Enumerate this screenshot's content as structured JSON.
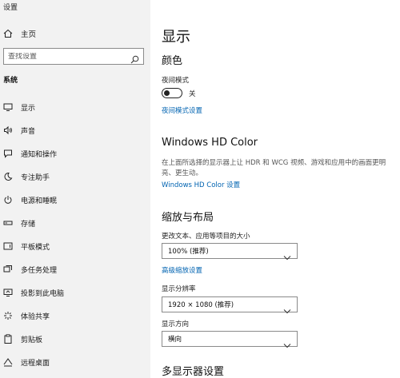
{
  "window": {
    "title": "设置"
  },
  "sidebar": {
    "home_label": "主页",
    "search_placeholder": "查找设置",
    "section_header": "系统",
    "items": [
      {
        "label": "显示",
        "icon": "monitor-icon"
      },
      {
        "label": "声音",
        "icon": "speaker-icon"
      },
      {
        "label": "通知和操作",
        "icon": "notification-icon"
      },
      {
        "label": "专注助手",
        "icon": "moon-icon"
      },
      {
        "label": "电源和睡眠",
        "icon": "power-icon"
      },
      {
        "label": "存储",
        "icon": "storage-icon"
      },
      {
        "label": "平板模式",
        "icon": "tablet-icon"
      },
      {
        "label": "多任务处理",
        "icon": "multitask-icon"
      },
      {
        "label": "投影到此电脑",
        "icon": "project-icon"
      },
      {
        "label": "体验共享",
        "icon": "share-icon"
      },
      {
        "label": "剪贴板",
        "icon": "clipboard-icon"
      },
      {
        "label": "远程桌面",
        "icon": "remote-desktop-icon"
      }
    ]
  },
  "main": {
    "title": "显示",
    "color": {
      "heading": "颜色",
      "night_light_label": "夜间模式",
      "night_light_state": "关",
      "night_light_on": false,
      "night_light_settings_link": "夜间模式设置"
    },
    "hdr": {
      "heading": "Windows HD Color",
      "description": "在上面所选择的显示器上让 HDR 和 WCG 视频、游戏和应用中的画面更明亮、更生动。",
      "settings_link": "Windows HD Color 设置"
    },
    "scale": {
      "heading": "缩放与布局",
      "text_size_label": "更改文本、应用等项目的大小",
      "text_size_value": "100% (推荐)",
      "advanced_link": "高级缩放设置",
      "resolution_label": "显示分辨率",
      "resolution_value": "1920 × 1080 (推荐)",
      "orientation_label": "显示方向",
      "orientation_value": "横向"
    },
    "multi_display": {
      "heading": "多显示器设置"
    }
  }
}
